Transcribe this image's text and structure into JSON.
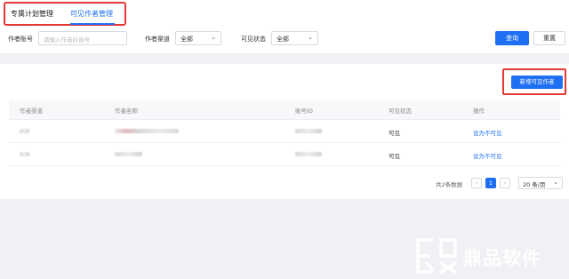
{
  "tabs": [
    {
      "label": "专属计划管理"
    },
    {
      "label": "可见作者管理"
    }
  ],
  "filters": {
    "account_label": "作者账号",
    "account_placeholder": "请输入作者抖音号",
    "channel_label": "作者渠道",
    "channel_value": "全部",
    "visibility_label": "可见状态",
    "visibility_value": "全部",
    "query_button": "查询",
    "reset_button": "重置"
  },
  "actions": {
    "add_button": "新增可见作者"
  },
  "table": {
    "headers": [
      "作者渠道",
      "作者名称",
      "账号ID",
      "可见状态",
      "操作"
    ],
    "rows": [
      {
        "status": "可见",
        "action": "设为不可见"
      },
      {
        "status": "可见",
        "action": "设为不可见"
      }
    ]
  },
  "pagination": {
    "total": "共2条数据",
    "current_page": "1",
    "page_size": "20 条/页",
    "prev_icon": "chevron-left-icon",
    "next_icon": "chevron-right-icon"
  },
  "watermark": {
    "text": "鼎品软件"
  },
  "colors": {
    "primary": "#1f6ff2",
    "highlight": "#e53935"
  }
}
